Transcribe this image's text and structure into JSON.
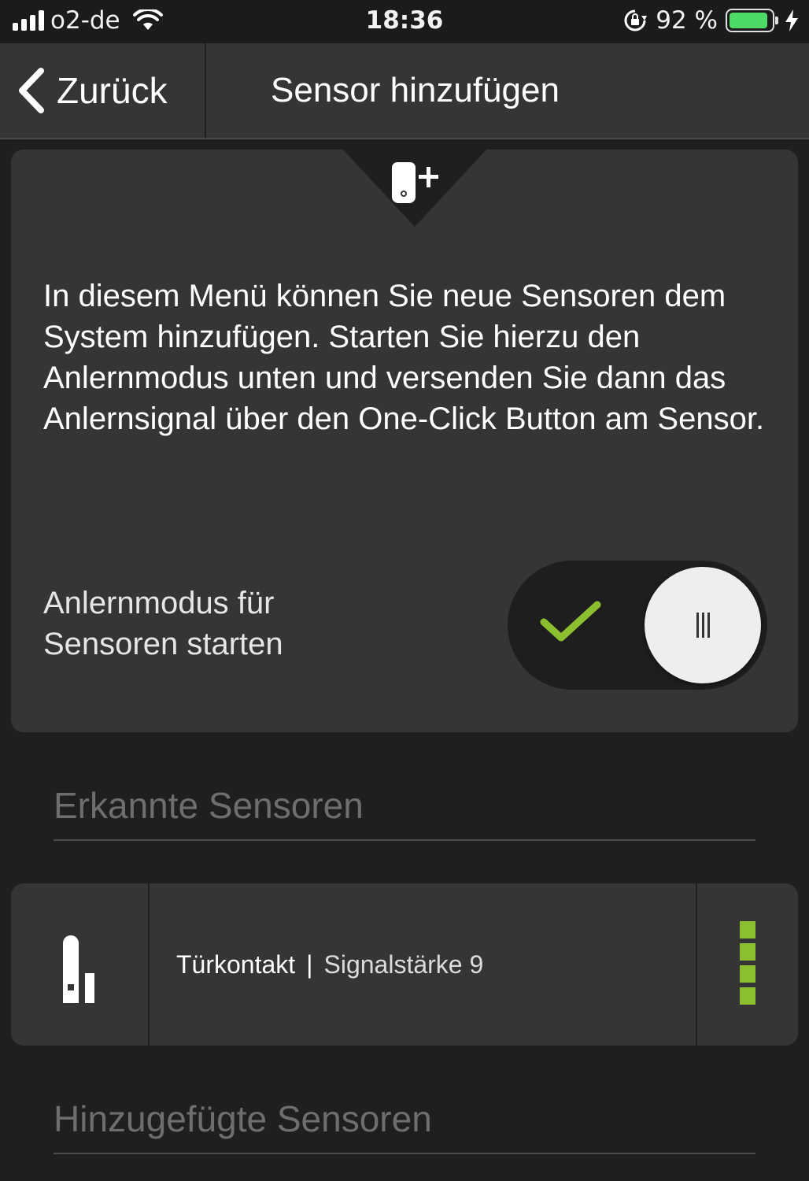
{
  "status_bar": {
    "carrier": "o2-de",
    "time": "18:36",
    "battery_percent": "92 %",
    "battery_level": 0.92,
    "icons": [
      "signal-icon",
      "wifi-icon",
      "orientation-lock-icon",
      "battery-icon",
      "charging-icon"
    ]
  },
  "nav": {
    "back_label": "Zurück",
    "title": "Sensor hinzufügen"
  },
  "card": {
    "icon": "sensor-add-icon",
    "description": "In diesem Menü können Sie neue Sensoren dem System hinzufügen. Starten Sie hierzu den Anlernmodus unten und versenden Sie dann das Anlernsignal über den One-Click Button am Sensor.",
    "toggle_label_line1": "Anlernmodus für",
    "toggle_label_line2": "Sensoren starten",
    "toggle_on": true
  },
  "sections": {
    "detected_title": "Erkannte Sensoren",
    "added_title": "Hinzugefügte Sensoren"
  },
  "detected_sensors": [
    {
      "name": "Türkontakt",
      "separator": "|",
      "strength_label": "Signalstärke 9",
      "signal_bars": 4
    }
  ],
  "colors": {
    "accent_green": "#8cbf2f",
    "card_bg": "#353536",
    "page_bg": "#1f1f20"
  }
}
